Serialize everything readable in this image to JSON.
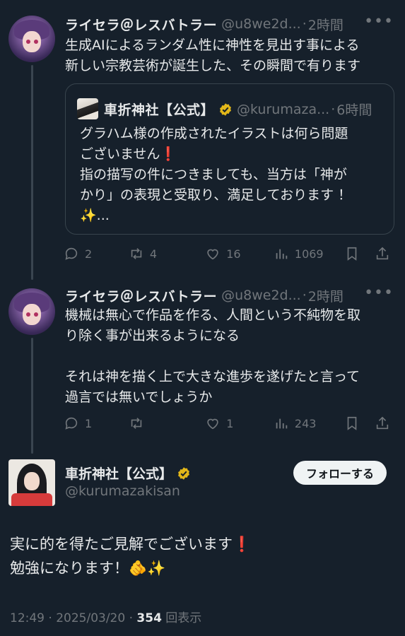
{
  "tweet1": {
    "name": "ライセラ＠レスバトラー",
    "handle": "@u8we2d...",
    "time": "2時間",
    "text": "生成AIによるランダム性に神性を見出す事による\n新しい宗教芸術が誕生した、その瞬間で有ります",
    "quote": {
      "name": "車折神社【公式】",
      "handle": "@kurumaza...",
      "time": "6時間",
      "text": "グラハム様の作成されたイラストは何ら問題\nございません❗\n指の描写の件につきましても、当方は「神が\nかり」の表現と受取り、満足しております ！\n✨..."
    },
    "actions": {
      "replies": "2",
      "retweets": "4",
      "likes": "16",
      "views": "1069"
    }
  },
  "tweet2": {
    "name": "ライセラ＠レスバトラー",
    "handle": "@u8we2d...",
    "time": "2時間",
    "text": "機械は無心で作品を作る、人間という不純物を取\nり除く事が出来るようになる\n\nそれは神を描く上で大きな進歩を遂げたと言って\n過言では無いでしょうか",
    "actions": {
      "replies": "1",
      "retweets": "",
      "likes": "1",
      "views": "243"
    }
  },
  "main": {
    "name": "車折神社【公式】",
    "handle": "@kurumazakisan",
    "follow_label": "フォローする",
    "text": "実に的を得たご見解でございます❗\n勉強になります！🫵✨",
    "meta_time": "12:49 · 2025/03/20 · ",
    "meta_views": "354",
    "meta_views_label": " 回表示"
  },
  "colors": {
    "background": "#16202b",
    "muted": "#71767b",
    "verified_gold": "#e2b719"
  }
}
